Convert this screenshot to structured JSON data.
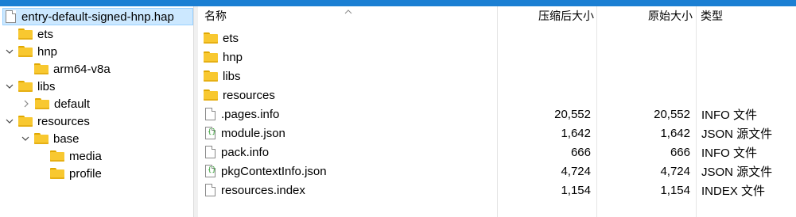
{
  "tree": {
    "items": [
      {
        "label": "entry-default-signed-hnp.hap",
        "icon": "file-icon",
        "twisty": "none",
        "level": 0,
        "selected": true
      },
      {
        "label": "ets",
        "icon": "folder-icon",
        "twisty": "none",
        "level": 1
      },
      {
        "label": "hnp",
        "icon": "folder-icon",
        "twisty": "expanded",
        "level": 0
      },
      {
        "label": "arm64-v8a",
        "icon": "folder-icon",
        "twisty": "none",
        "level": 2
      },
      {
        "label": "libs",
        "icon": "folder-icon",
        "twisty": "expanded",
        "level": 0
      },
      {
        "label": "default",
        "icon": "folder-icon",
        "twisty": "collapsed",
        "level": 1
      },
      {
        "label": "resources",
        "icon": "folder-icon",
        "twisty": "expanded",
        "level": 0
      },
      {
        "label": "base",
        "icon": "folder-icon",
        "twisty": "expanded",
        "level": 1
      },
      {
        "label": "media",
        "icon": "folder-icon",
        "twisty": "none",
        "level": 2
      },
      {
        "label": "profile",
        "icon": "folder-icon",
        "twisty": "none",
        "level": 2
      }
    ]
  },
  "list": {
    "headers": {
      "name": "名称",
      "compressed": "压缩后大小",
      "original": "原始大小",
      "type": "类型"
    },
    "rows": [
      {
        "name": "ets",
        "icon": "folder-icon",
        "compressed": "",
        "original": "",
        "type": ""
      },
      {
        "name": "hnp",
        "icon": "folder-icon",
        "compressed": "",
        "original": "",
        "type": ""
      },
      {
        "name": "libs",
        "icon": "folder-icon",
        "compressed": "",
        "original": "",
        "type": ""
      },
      {
        "name": "resources",
        "icon": "folder-icon",
        "compressed": "",
        "original": "",
        "type": ""
      },
      {
        "name": ".pages.info",
        "icon": "file-icon",
        "compressed": "20,552",
        "original": "20,552",
        "type": "INFO 文件"
      },
      {
        "name": "module.json",
        "icon": "json-file-icon",
        "compressed": "1,642",
        "original": "1,642",
        "type": "JSON 源文件"
      },
      {
        "name": "pack.info",
        "icon": "file-icon",
        "compressed": "666",
        "original": "666",
        "type": "INFO 文件"
      },
      {
        "name": "pkgContextInfo.json",
        "icon": "json-file-icon",
        "compressed": "4,724",
        "original": "4,724",
        "type": "JSON 源文件"
      },
      {
        "name": "resources.index",
        "icon": "file-icon",
        "compressed": "1,154",
        "original": "1,154",
        "type": "INDEX 文件"
      }
    ]
  },
  "colors": {
    "accent": "#1b7fd3",
    "selection": "#cce8ff",
    "folder": "#f8c830"
  }
}
